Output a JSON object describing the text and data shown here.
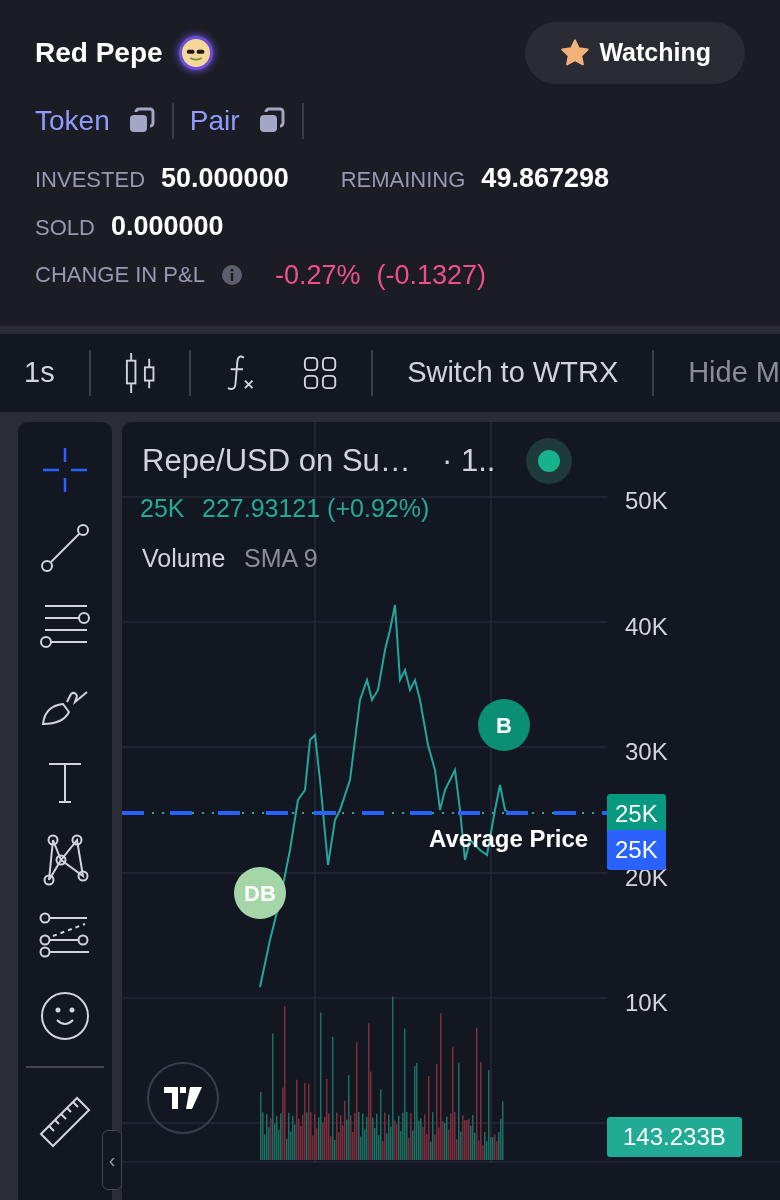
{
  "header": {
    "title": "Red Pepe",
    "watch_button": {
      "label": "Watching",
      "on": true
    },
    "links": [
      {
        "label": "Token"
      },
      {
        "label": "Pair"
      }
    ],
    "stats": [
      {
        "label": "INVESTED",
        "value": "50.000000"
      },
      {
        "label": "REMAINING",
        "value": "49.867298"
      },
      {
        "label": "SOLD",
        "value": "0.000000"
      }
    ],
    "pnl": {
      "label": "CHANGE IN P&L",
      "percent": "-0.27%",
      "amount": "(-0.1327)"
    }
  },
  "toolbar": {
    "interval": "1s",
    "switch_label": "Switch to WTRX",
    "hide_label": "Hide M"
  },
  "drawing_tools": [
    {
      "kind": "crosshair",
      "selected": true
    },
    {
      "kind": "trend-line",
      "selected": false
    },
    {
      "kind": "lines",
      "selected": false
    },
    {
      "kind": "brush",
      "selected": false
    },
    {
      "kind": "text",
      "selected": false
    },
    {
      "kind": "pattern",
      "selected": false
    },
    {
      "kind": "fib",
      "selected": false
    },
    {
      "kind": "emoji",
      "selected": false
    },
    {
      "kind": "ruler",
      "selected": false
    }
  ],
  "collapse_glyph": "‹",
  "chart": {
    "symbol": "Repe/USD on Su…",
    "interval": "· 1..",
    "live": true,
    "price_value": "25K",
    "price_change": "227.93121 (+0.92%)",
    "volume_label": "Volume",
    "volume_ma": "SMA 9",
    "y_axis": [
      "50K",
      "40K",
      "30K",
      "20K",
      "10K"
    ],
    "price_badges": [
      {
        "text": "25K",
        "color": "#089981"
      },
      {
        "text": "25K",
        "color": "#2962ff"
      }
    ],
    "volume_badge": "143.233B",
    "markers": [
      {
        "label": "B",
        "color": "#0b8f74"
      },
      {
        "label": "DB",
        "color": "#a5d6a7"
      }
    ],
    "average_label": "Average Price"
  }
}
